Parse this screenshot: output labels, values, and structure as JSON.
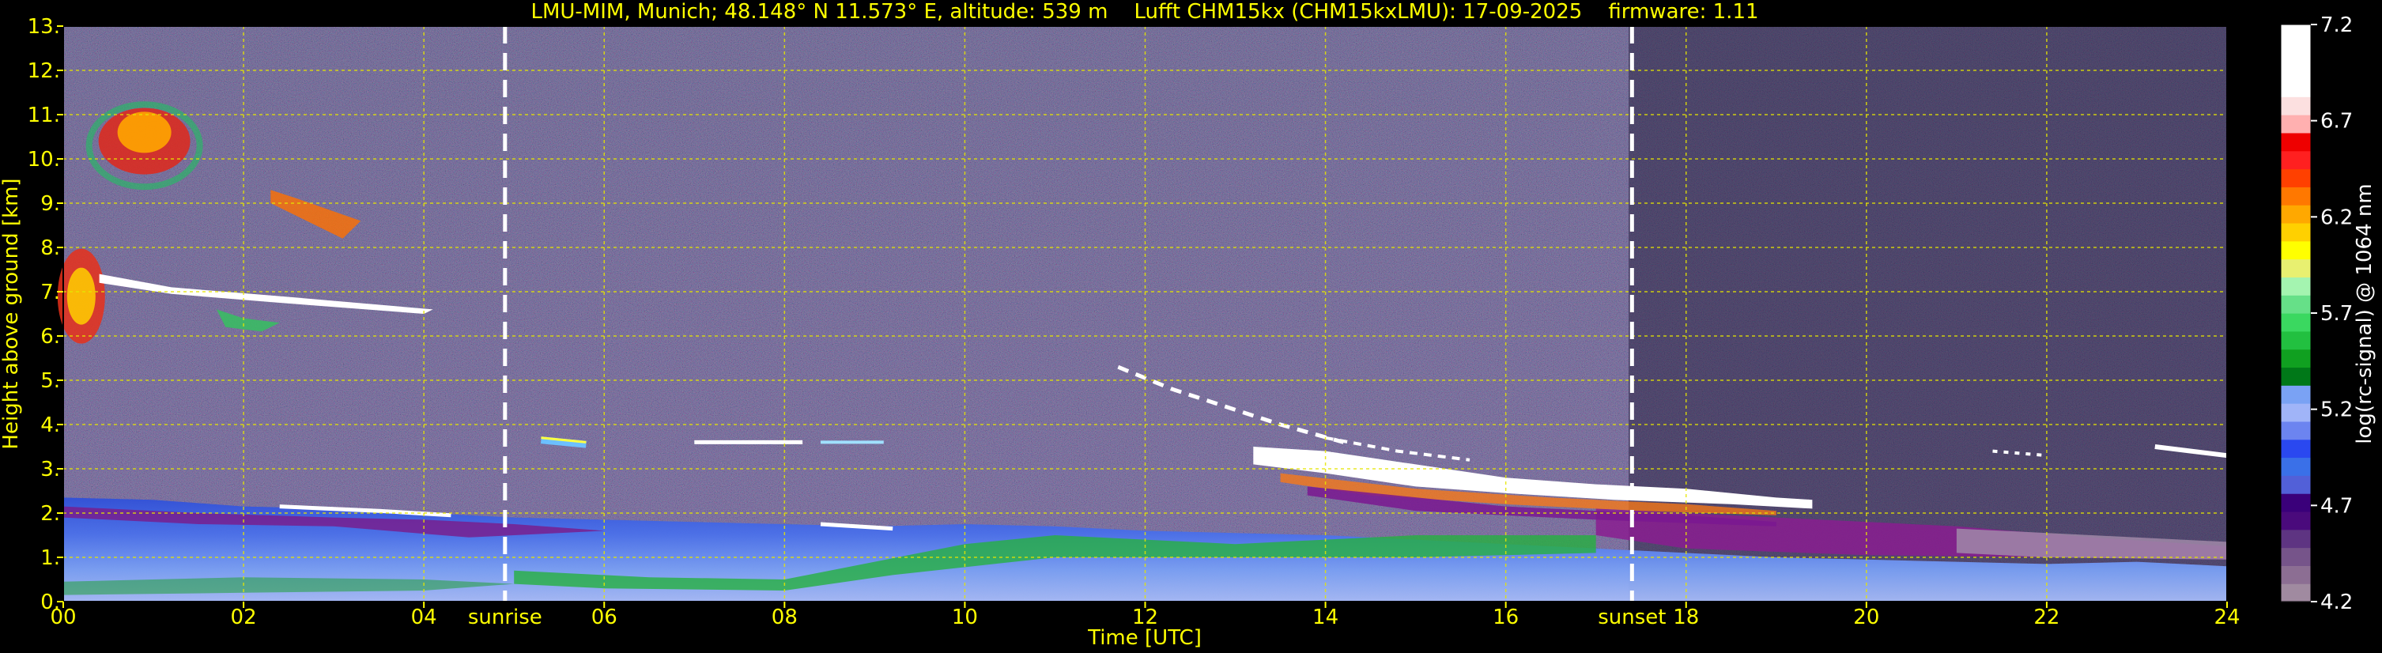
{
  "chart_data": {
    "type": "heatmap",
    "title": "LMU-MIM, Munich; 48.148° N 11.573° E, altitude: 539 m    Lufft CHM15kx (CHM15kxLMU): 17-09-2025    firmware: 1.11",
    "xlabel": "Time [UTC]",
    "ylabel": "Height above ground [km]",
    "xlim": [
      0,
      24
    ],
    "ylim": [
      0,
      13
    ],
    "x_ticks": [
      "00",
      "02",
      "04",
      "06",
      "08",
      "10",
      "12",
      "14",
      "16",
      "18",
      "20",
      "22",
      "24"
    ],
    "y_ticks": [
      "0.",
      "1.",
      "2.",
      "3.",
      "4.",
      "5.",
      "6.",
      "7.",
      "8.",
      "9.",
      "10.",
      "11.",
      "12.",
      "13."
    ],
    "grid": true,
    "markers": [
      {
        "label": "sunrise",
        "x": 4.9
      },
      {
        "label": "sunset",
        "x": 17.4
      }
    ],
    "colorbar": {
      "label": "log(rc-signal) @ 1064 nm",
      "min": 4.2,
      "max": 7.2,
      "ticks": [
        "4.2",
        "4.7",
        "5.2",
        "5.7",
        "6.2",
        "6.7",
        "7.2"
      ],
      "colors": [
        "#a08aa0",
        "#8c6e93",
        "#76548a",
        "#5e3482",
        "#4a0a7c",
        "#3a007a",
        "#5260d8",
        "#3a70e8",
        "#2a48f0",
        "#6c84f0",
        "#a0b4f8",
        "#7aa2f4",
        "#007818",
        "#10a020",
        "#22c040",
        "#3ad860",
        "#66e088",
        "#a4f4b0",
        "#e8f070",
        "#ffff00",
        "#ffd000",
        "#ffa800",
        "#ff7800",
        "#ff4000",
        "#ff2020",
        "#ee0000",
        "#ffb0b0",
        "#fce0e0",
        "#ffffff",
        "#ffffff",
        "#ffffff",
        "#ffffff"
      ]
    },
    "features": [
      {
        "name": "boundary layer aerosol",
        "x": [
          0,
          24
        ],
        "y": [
          0,
          2.4
        ]
      },
      {
        "name": "elevated aerosol layer",
        "x": [
          17,
          24
        ],
        "y": [
          0.5,
          2.0
        ]
      },
      {
        "name": "mid-level cloud 1",
        "x": [
          2.3,
          4.1
        ],
        "y": [
          6.9,
          7.4
        ]
      },
      {
        "name": "mid-level cloud 2",
        "x": [
          5.3,
          9.2
        ],
        "y": [
          3.5,
          3.7
        ]
      },
      {
        "name": "mid-level cloud 3",
        "x": [
          11.6,
          19.4
        ],
        "y": [
          2.0,
          5.0
        ]
      },
      {
        "name": "cirrus",
        "x": [
          0.3,
          4.0
        ],
        "y": [
          6.0,
          11.3
        ]
      },
      {
        "name": "late cloud",
        "x": [
          21.4,
          24
        ],
        "y": [
          3.0,
          3.6
        ]
      }
    ]
  }
}
